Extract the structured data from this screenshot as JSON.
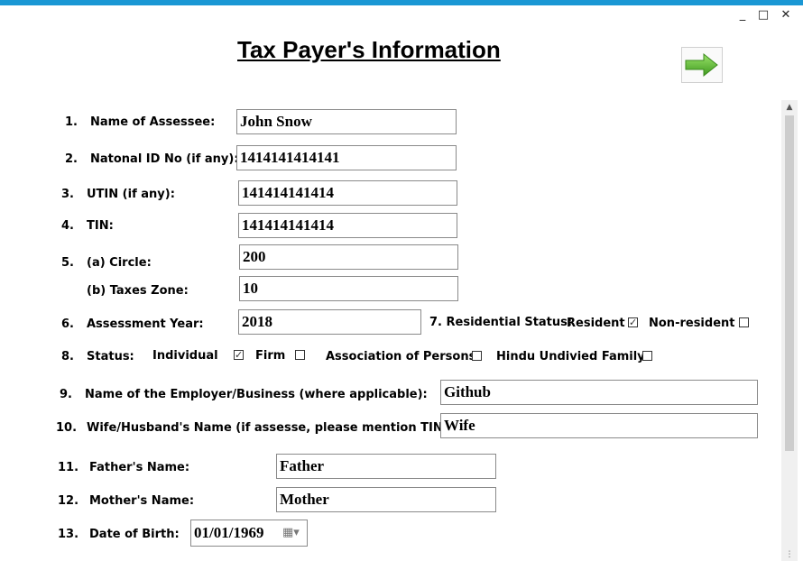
{
  "window": {
    "minimize": "_",
    "maximize": "□",
    "close": "✕"
  },
  "title": "Tax Payer's Information",
  "fields": {
    "f1": {
      "num": "1.",
      "label": "Name of Assessee:",
      "value": "John Snow"
    },
    "f2": {
      "num": "2.",
      "label": "Natonal ID No (if any):",
      "value": "1414141414141"
    },
    "f3": {
      "num": "3.",
      "label": "UTIN (if any):",
      "value": "141414141414"
    },
    "f4": {
      "num": "4.",
      "label": "TIN:",
      "value": "141414141414"
    },
    "f5a": {
      "num": "5.",
      "label": "(a) Circle:",
      "value": "200"
    },
    "f5b": {
      "label": "(b) Taxes Zone:",
      "value": "10"
    },
    "f6": {
      "num": "6.",
      "label": "Assessment Year:",
      "value": "2018"
    },
    "f9": {
      "num": "9.",
      "label": "Name of the Employer/Business (where applicable):",
      "value": "Github"
    },
    "f10": {
      "num": "10.",
      "label": "Wife/Husband's Name (if assesse, please mention TIN):",
      "value": "Wife"
    },
    "f11": {
      "num": "11.",
      "label": "Father's Name:",
      "value": "Father"
    },
    "f12": {
      "num": "12.",
      "label": "Mother's Name:",
      "value": "Mother"
    },
    "f13": {
      "num": "13.",
      "label": "Date of Birth:",
      "value": "01/01/1969"
    }
  },
  "residential": {
    "label": "7. Residential Status:",
    "options": [
      {
        "label": "Resident",
        "checked": true,
        "mark": "✓"
      },
      {
        "label": "Non-resident",
        "checked": false,
        "mark": ""
      }
    ]
  },
  "status": {
    "num": "8.",
    "label": "Status:",
    "options": [
      {
        "label": "Individual",
        "checked": true,
        "mark": "✓"
      },
      {
        "label": "Firm",
        "checked": false,
        "mark": ""
      },
      {
        "label": "Association of Persons",
        "checked": false,
        "mark": ""
      },
      {
        "label": "Hindu Undivied Family",
        "checked": false,
        "mark": ""
      }
    ]
  },
  "icons": {
    "next": "green-right-arrow",
    "calendar": "calendar-dropdown",
    "scroll_up": "chevron-up"
  },
  "colors": {
    "accent": "#1a97d4",
    "arrow": "#6cc13b"
  }
}
